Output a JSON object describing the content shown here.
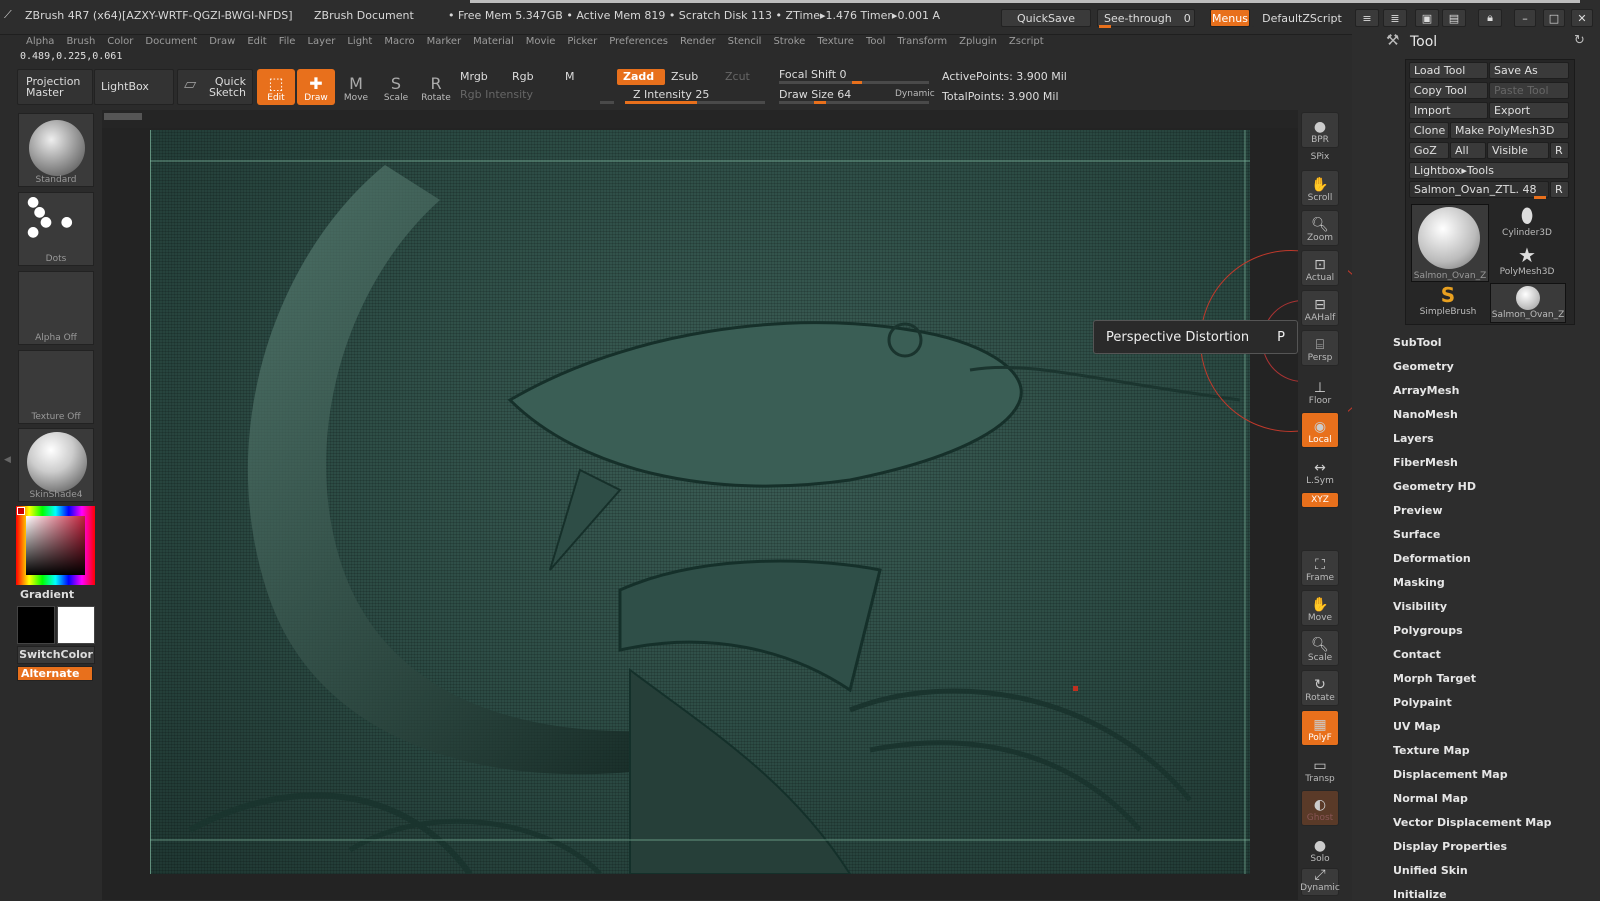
{
  "titlebar": {
    "app_title": "ZBrush 4R7 (x64)[AZXY-WRTF-QGZI-BWGI-NFDS]",
    "document": "ZBrush Document",
    "stats": "• Free Mem 5.347GB • Active Mem 819 • Scratch Disk 113 • ZTime▸1.476 Timer▸0.001 A",
    "quicksave": "QuickSave",
    "see_through_label": "See-through",
    "see_through_value": "0",
    "menus_label": "Menus",
    "default_script": "DefaultZScript"
  },
  "menubar": [
    "Alpha",
    "Brush",
    "Color",
    "Document",
    "Draw",
    "Edit",
    "File",
    "Layer",
    "Light",
    "Macro",
    "Marker",
    "Material",
    "Movie",
    "Picker",
    "Preferences",
    "Render",
    "Stencil",
    "Stroke",
    "Texture",
    "Tool",
    "Transform",
    "Zplugin",
    "Zscript"
  ],
  "coords": "0.489,0.225,0.061",
  "toolbar": {
    "projection_master": "Projection Master",
    "lightbox": "LightBox",
    "quick_sketch": "Quick Sketch",
    "edit": "Edit",
    "draw": "Draw",
    "move": "Move",
    "scale": "Scale",
    "rotate": "Rotate",
    "mrgb": "Mrgb",
    "rgb": "Rgb",
    "m": "M",
    "rgb_intensity": "Rgb Intensity",
    "zadd": "Zadd",
    "zsub": "Zsub",
    "zcut": "Zcut",
    "z_intensity": "Z Intensity 25",
    "focal_shift": "Focal Shift 0",
    "draw_size": "Draw Size 64",
    "dynamic": "Dynamic",
    "active_points": "ActivePoints: 3.900 Mil",
    "total_points": "TotalPoints: 3.900 Mil"
  },
  "left_shelf": {
    "brush": "Standard",
    "stroke": "Dots",
    "alpha": "Alpha Off",
    "texture": "Texture Off",
    "material": "SkinShade4",
    "gradient": "Gradient",
    "switch_color": "SwitchColor",
    "alternate": "Alternate"
  },
  "right_shelf": [
    "BPR",
    "SPix",
    "Scroll",
    "Zoom",
    "Actual",
    "AAHalf",
    "Persp",
    "Floor",
    "Local",
    "L.Sym",
    "XYZ",
    "Frame",
    "Move",
    "Scale",
    "Rotate",
    "PolyF",
    "Transp",
    "Ghost",
    "Solo",
    "Dynamic"
  ],
  "tooltip": {
    "label": "Perspective Distortion",
    "shortcut": "P"
  },
  "tool_panel": {
    "title": "Tool",
    "load_tool": "Load Tool",
    "save_as": "Save As",
    "copy_tool": "Copy Tool",
    "paste_tool": "Paste Tool",
    "import": "Import",
    "export": "Export",
    "clone": "Clone",
    "make_polymesh": "Make PolyMesh3D",
    "goz": "GoZ",
    "all": "All",
    "visible": "Visible",
    "r": "R",
    "lightbox_tools": "Lightbox▸Tools",
    "current_tool": "Salmon_Ovan_ZTL. 48",
    "thumbs": [
      "Salmon_Ovan_Z",
      "Cylinder3D",
      "PolyMesh3D",
      "SimpleBrush",
      "Salmon_Ovan_Z"
    ],
    "subpalettes": [
      "SubTool",
      "Geometry",
      "ArrayMesh",
      "NanoMesh",
      "Layers",
      "FiberMesh",
      "Geometry HD",
      "Preview",
      "Surface",
      "Deformation",
      "Masking",
      "Visibility",
      "Polygroups",
      "Contact",
      "Morph Target",
      "Polypaint",
      "UV Map",
      "Texture Map",
      "Displacement Map",
      "Normal Map",
      "Vector Displacement Map",
      "Display Properties",
      "Unified Skin",
      "Initialize"
    ]
  },
  "colors": {
    "accent": "#e8701c",
    "canvas": "#2f4f48"
  }
}
